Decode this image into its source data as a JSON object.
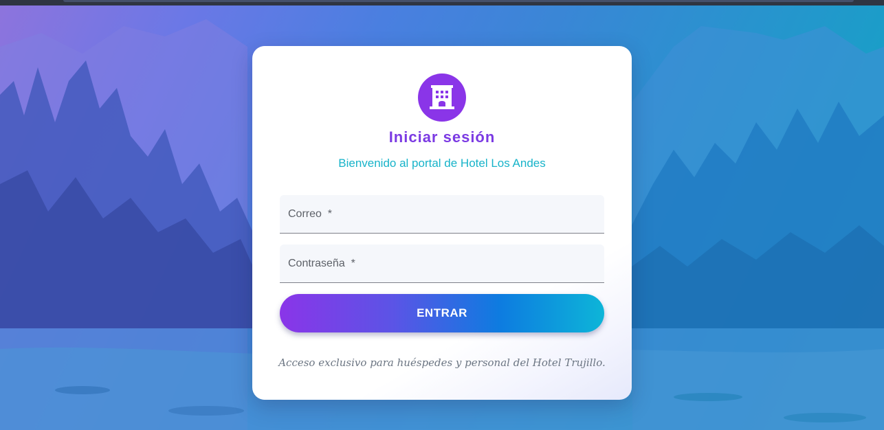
{
  "login": {
    "title": "Iniciar sesión",
    "subtitle": "Bienvenido al portal de Hotel Los Andes",
    "email_placeholder": "Correo  *",
    "password_placeholder": "Contraseña  *",
    "submit_label": "ENTRAR",
    "footer_note": "Acceso exclusivo para huéspedes y personal del Hotel Trujillo."
  },
  "icons": {
    "logo": "hotel-building-icon"
  },
  "colors": {
    "accent_purple": "#8a35e8",
    "accent_cyan": "#17b3c9",
    "button_gradient_start": "#8a35e8",
    "button_gradient_end": "#0db5d8"
  }
}
